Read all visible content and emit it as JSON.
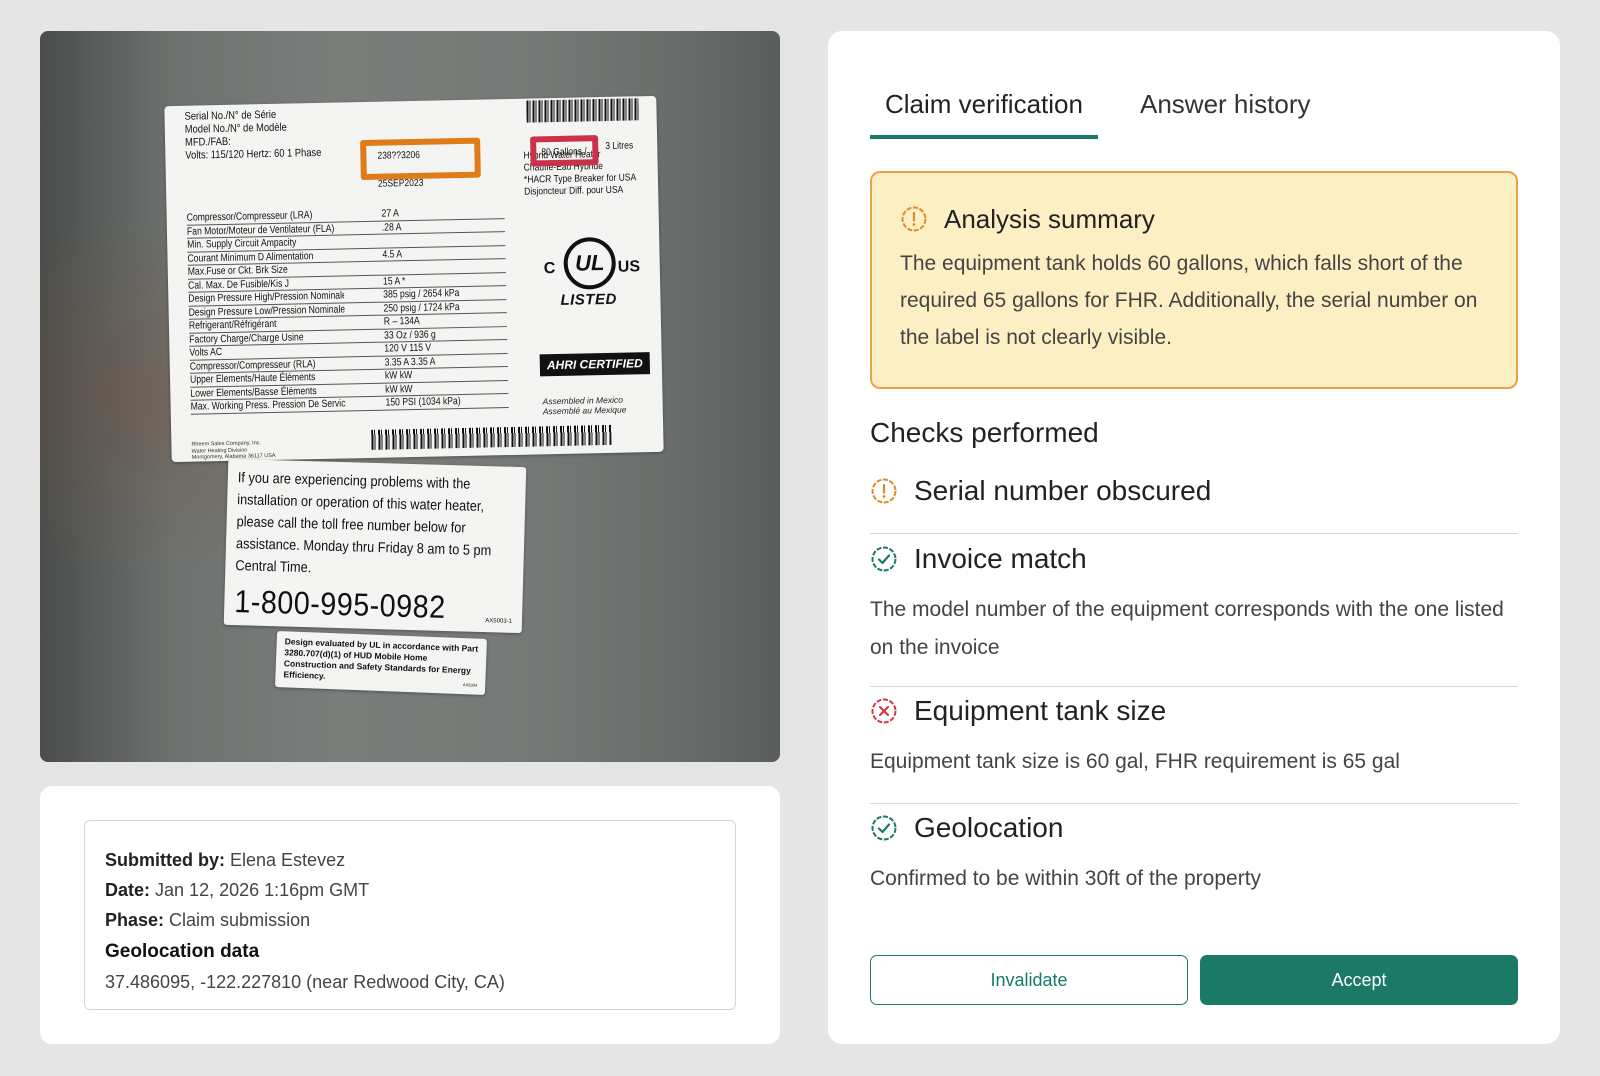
{
  "photo": {
    "label": {
      "spec_top": [
        "Serial No./N° de Série",
        "Model No./N° de Modèle",
        "MFD./FAB:",
        "Volts: 115/120     Hertz: 60     1 Phase"
      ],
      "serial_value": "238??3206",
      "mfd_value": "25SEP2023",
      "gallons_value": "80 Gallons /",
      "litres_value": "3 Litres",
      "specs": [
        {
          "k": "Compressor/Compresseur (LRA)",
          "v": "27 A"
        },
        {
          "k": "Fan Motor/Moteur de Ventilateur (FLA)",
          "v": ".28 A"
        },
        {
          "k": "Min. Supply Circuit Ampacity",
          "v": ""
        },
        {
          "k": "Courant Minimum D Alimentation",
          "v": "4.5 A"
        },
        {
          "k": "Max.Fuse or Ckt. Brk Size",
          "v": ""
        },
        {
          "k": "Cal. Max. De Fusible/Kis J",
          "v": "15 A *"
        },
        {
          "k": "Design Pressure High/Pression Nominale Haute",
          "v": "385 psig / 2654 kPa"
        },
        {
          "k": "Design Pressure Low/Pression Nominale Basse",
          "v": "250 psig / 1724 kPa"
        },
        {
          "k": "Refrigerant/Réfrigérant",
          "v": "R – 134A"
        },
        {
          "k": "Factory Charge/Charge Usine",
          "v": "33 Oz / 936 g"
        },
        {
          "k": "Volts AC",
          "v": "120 V   115 V"
        },
        {
          "k": "Compressor/Compresseur (RLA)",
          "v": "3.35 A   3.35 A"
        },
        {
          "k": "Upper Elements/Haute Éléments",
          "v": "kW   kW"
        },
        {
          "k": "Lower Elements/Basse Éléments",
          "v": "kW   kW"
        },
        {
          "k": "Max. Working Press. Pression De Servic Max De",
          "v": "150 PSI (1034 kPa)"
        }
      ],
      "side_text": [
        "Hybrid Water Heater",
        "Chauffe-Eau Hybride",
        "*HACR Type Breaker for USA",
        "Disjoncteur Diff. pour USA"
      ],
      "ul_c": "C",
      "ul_mark": "UL",
      "ul_us": "US",
      "ul_listed": "LISTED",
      "ahri": "AHRI CERTIFIED",
      "assembled": [
        "Assembled in Mexico",
        "Assemblé au Mexique"
      ],
      "maker": [
        "Rheem Sales Company, Inc.",
        "Water Heating Division",
        "Montgomery, Alabama 36117 USA"
      ]
    },
    "info_label": {
      "message": "If you are experiencing problems with the installation or operation of this water heater, please call the toll free number below for assistance. Monday thru Friday 8 am to 5 pm Central Time.",
      "phone": "1-800-995-0982",
      "code": "AX5003-1"
    },
    "hud_label": {
      "text": "Design evaluated by UL in accordance with Part 3280.707(d)(1) of HUD Mobile Home Construction and Safety Standards for Energy Efficiency.",
      "code": "AX5004"
    },
    "highlight_colors": {
      "serial": "#e07b1a",
      "gallons": "#c8324a"
    }
  },
  "submission": {
    "submitted_by_label": "Submitted by:",
    "submitted_by": "Elena Estevez",
    "date_label": "Date:",
    "date": "Jan 12, 2026 1:16pm GMT",
    "phase_label": "Phase:",
    "phase": "Claim submission",
    "geo_title": "Geolocation data",
    "geo_value": "37.486095, -122.227810 (near Redwood City, CA)"
  },
  "panel": {
    "tabs": [
      {
        "label": "Claim verification",
        "active": true
      },
      {
        "label": "Answer history",
        "active": false
      }
    ],
    "summary": {
      "title": "Analysis summary",
      "icon": "warning-icon",
      "body": "The equipment tank holds 60 gallons, which falls short of the required 65 gallons for FHR. Additionally, the serial number on the label is not clearly visible."
    },
    "checks_title": "Checks performed",
    "checks": [
      {
        "title": "Serial number obscured",
        "status": "warning",
        "icon": "warning-icon",
        "description": ""
      },
      {
        "title": "Invoice match",
        "status": "pass",
        "icon": "check-badge-icon",
        "description": "The model number of the equipment corresponds with the one listed on the invoice"
      },
      {
        "title": "Equipment tank size",
        "status": "fail",
        "icon": "x-badge-icon",
        "description": "Equipment tank size is 60 gal, FHR requirement is 65 gal"
      },
      {
        "title": "Geolocation",
        "status": "pass",
        "icon": "check-badge-icon",
        "description": "Confirmed to be within 30ft of the property"
      }
    ],
    "buttons": {
      "invalidate": "Invalidate",
      "accept": "Accept"
    }
  },
  "colors": {
    "accent": "#1a7a66",
    "warning": "#e08a2a",
    "fail": "#d23a4a",
    "summary_bg": "#fcefc4",
    "summary_border": "#e8a24a"
  }
}
